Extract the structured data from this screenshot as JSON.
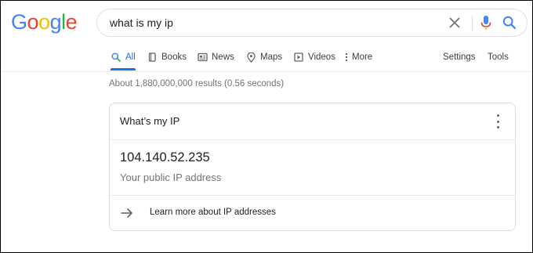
{
  "logo": {
    "text": "Google",
    "letters": [
      {
        "ch": "G",
        "color": "#4285F4"
      },
      {
        "ch": "o",
        "color": "#EA4335"
      },
      {
        "ch": "o",
        "color": "#FBBC05"
      },
      {
        "ch": "g",
        "color": "#4285F4"
      },
      {
        "ch": "l",
        "color": "#34A853"
      },
      {
        "ch": "e",
        "color": "#EA4335"
      }
    ]
  },
  "search": {
    "value": "what is my ip"
  },
  "icons": {
    "clear": "close-icon",
    "mic": "microphone-icon",
    "search": "search-icon"
  },
  "tabs": [
    {
      "label": "All",
      "icon": "search-icon",
      "active": true
    },
    {
      "label": "Books",
      "icon": "book-icon"
    },
    {
      "label": "News",
      "icon": "newspaper-icon"
    },
    {
      "label": "Maps",
      "icon": "map-pin-icon"
    },
    {
      "label": "Videos",
      "icon": "video-play-icon"
    },
    {
      "label": "More",
      "icon": "more-vertical-icon"
    }
  ],
  "tools": {
    "settings": "Settings",
    "tools": "Tools"
  },
  "stats": "About 1,880,000,000 results (0.56 seconds)",
  "card": {
    "title": "What’s my IP",
    "ip": "104.140.52.235",
    "caption": "Your public IP address",
    "learn_more": "Learn more about IP addresses"
  },
  "colors": {
    "accent": "#1a73e8",
    "text": "#202124",
    "muted": "#70757a",
    "mic_blue": "#4285F4",
    "mic_red": "#EA4335"
  }
}
